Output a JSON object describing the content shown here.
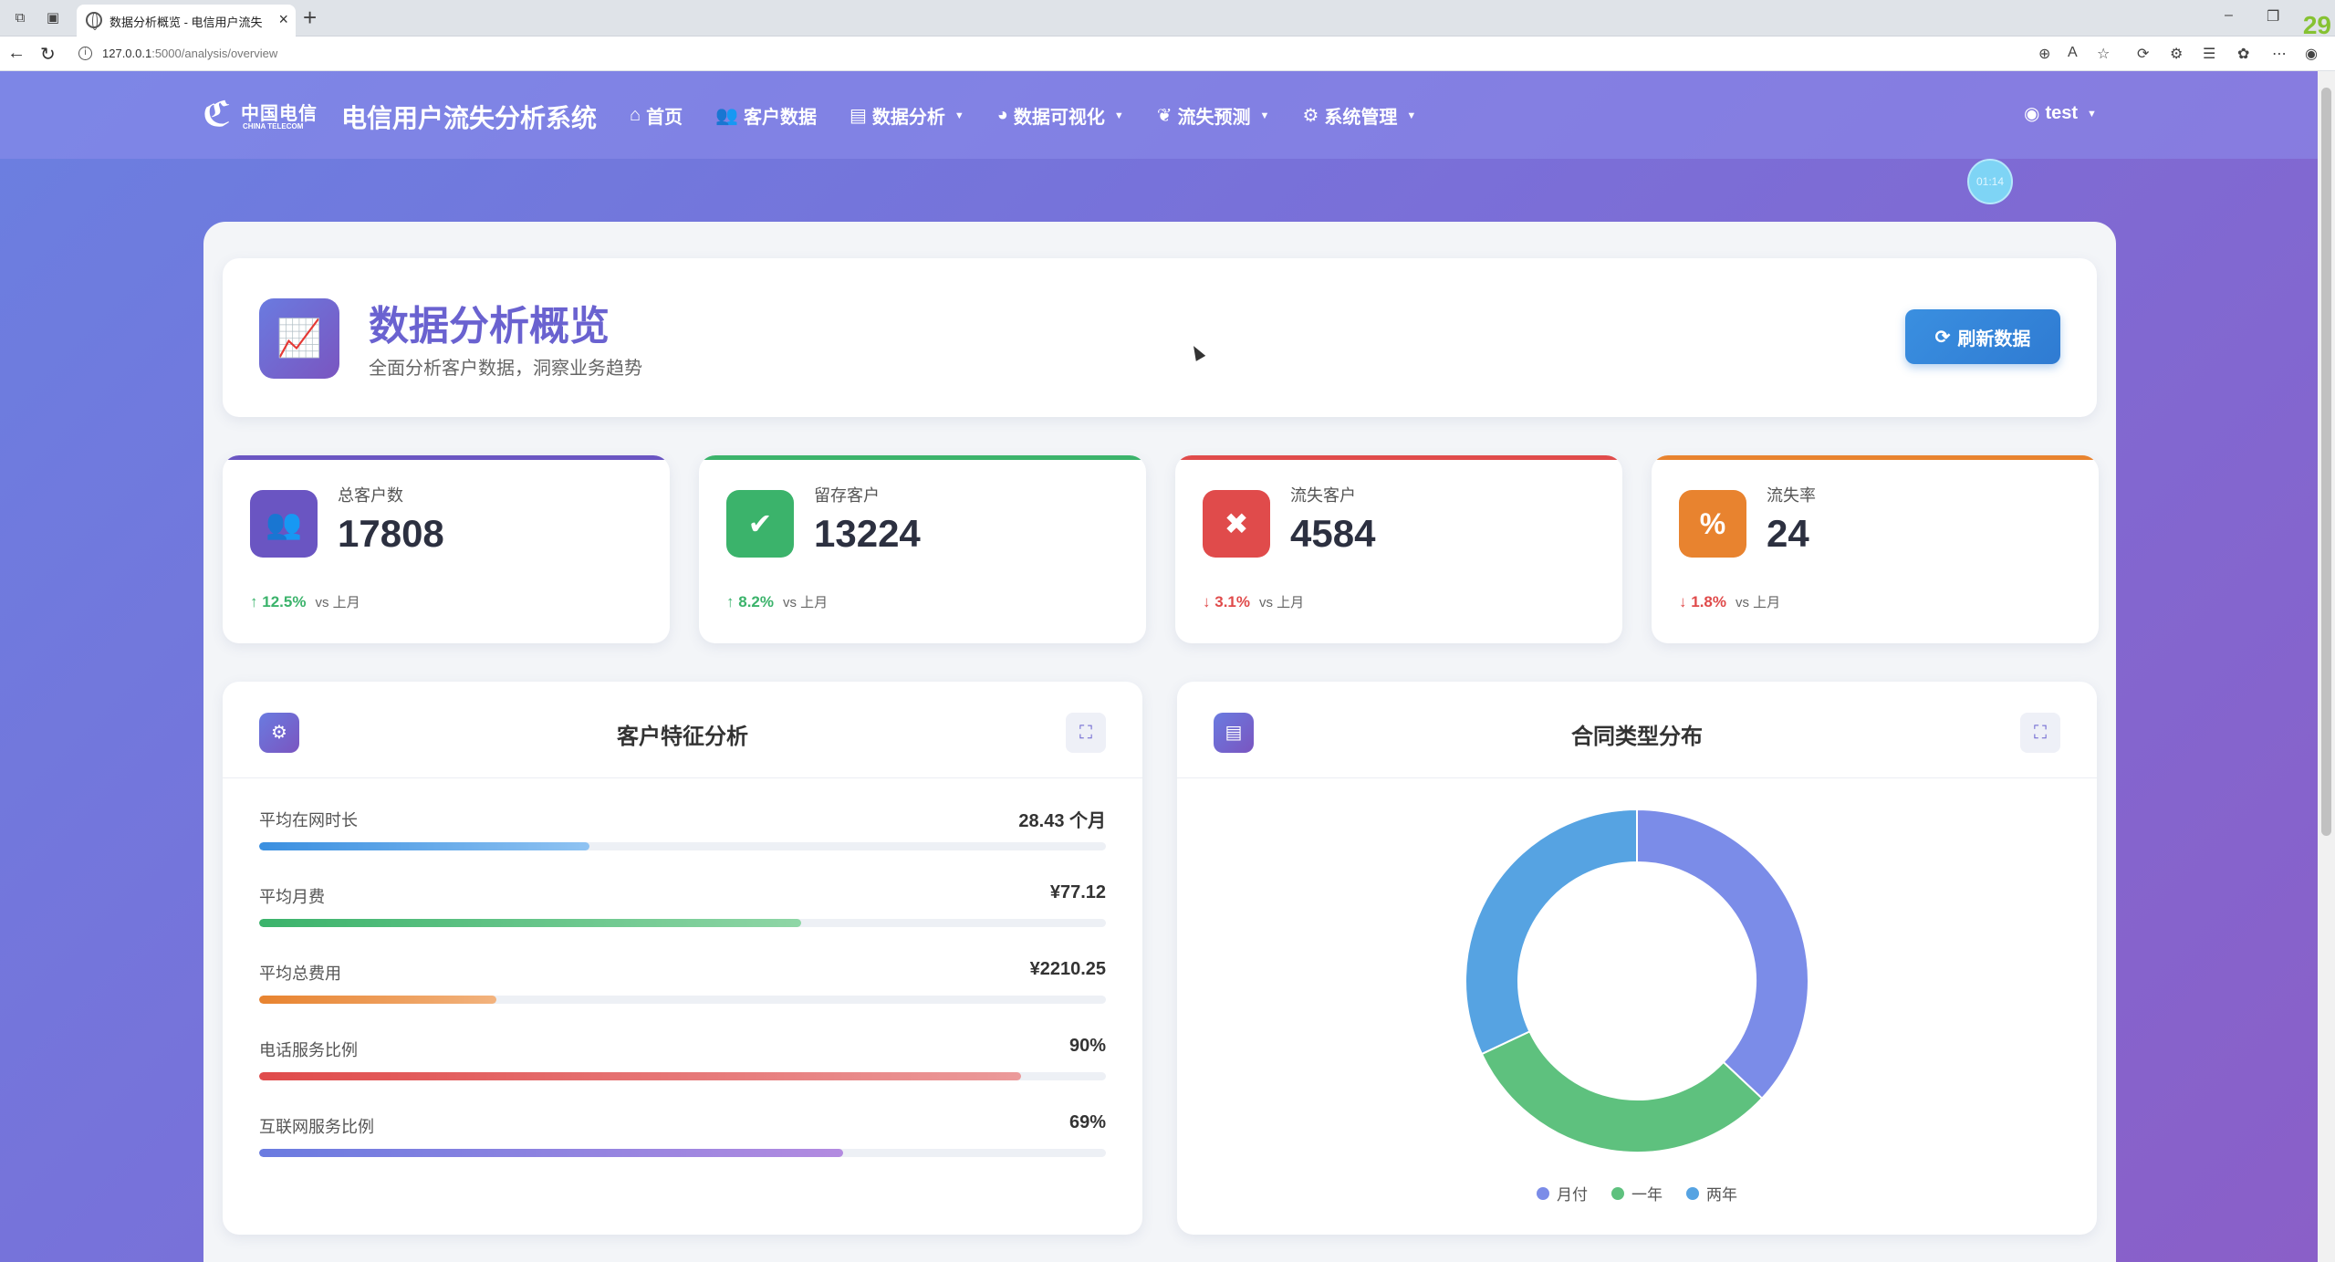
{
  "browser": {
    "tab_title": "数据分析概览 - 电信用户流失分析",
    "url_host": "127.0.0.1",
    "url_rest": ":5000/analysis/overview",
    "corner_number": "29"
  },
  "nav": {
    "logo_cn": "中国电信",
    "logo_en": "CHINA TELECOM",
    "brand": "电信用户流失分析系统",
    "items": [
      {
        "label": "首页",
        "icon": "home-icon",
        "dropdown": false
      },
      {
        "label": "客户数据",
        "icon": "users-icon",
        "dropdown": false
      },
      {
        "label": "数据分析",
        "icon": "bar-chart-icon",
        "dropdown": true
      },
      {
        "label": "数据可视化",
        "icon": "pie-chart-icon",
        "dropdown": true
      },
      {
        "label": "流失预测",
        "icon": "brain-icon",
        "dropdown": true
      },
      {
        "label": "系统管理",
        "icon": "gear-icon",
        "dropdown": true
      }
    ],
    "user": "test",
    "clock": "01:14"
  },
  "header": {
    "title": "数据分析概览",
    "subtitle": "全面分析客户数据，洞察业务趋势",
    "refresh_label": "刷新数据"
  },
  "stats": [
    {
      "label": "总客户数",
      "value": "17808",
      "trend": "12.5%",
      "direction": "up",
      "vs": "vs 上月",
      "color": "#6a55c2",
      "bar": "#6a55c2",
      "icon": "users-icon",
      "glyph": "👥"
    },
    {
      "label": "留存客户",
      "value": "13224",
      "trend": "8.2%",
      "direction": "up",
      "vs": "vs 上月",
      "color": "#3bb36b",
      "bar": "#3bb36b",
      "icon": "user-check-icon",
      "glyph": "✔"
    },
    {
      "label": "流失客户",
      "value": "4584",
      "trend": "3.1%",
      "direction": "down",
      "vs": "vs 上月",
      "color": "#e04b4b",
      "bar": "#e04b4b",
      "icon": "user-times-icon",
      "glyph": "✖"
    },
    {
      "label": "流失率",
      "value": "24",
      "trend": "1.8%",
      "direction": "down",
      "vs": "vs 上月",
      "color": "#e8832f",
      "bar": "#e8832f",
      "icon": "percent-icon",
      "glyph": "%"
    }
  ],
  "features": {
    "title": "客户特征分析",
    "metrics": [
      {
        "label": "平均在网时长",
        "value": "28.43 个月",
        "fill": 0.39,
        "c1": "#3a8fe0",
        "c2": "#8fc3f2"
      },
      {
        "label": "平均月费",
        "value": "¥77.12",
        "fill": 0.64,
        "c1": "#3bb36b",
        "c2": "#8fd6a6"
      },
      {
        "label": "平均总费用",
        "value": "¥2210.25",
        "fill": 0.28,
        "c1": "#e8832f",
        "c2": "#f2b37e"
      },
      {
        "label": "电话服务比例",
        "value": "90%",
        "fill": 0.9,
        "c1": "#e04b4b",
        "c2": "#eb9a9a"
      },
      {
        "label": "互联网服务比例",
        "value": "69%",
        "fill": 0.69,
        "c1": "#6a7be0",
        "c2": "#b38be0"
      }
    ]
  },
  "contract": {
    "title": "合同类型分布"
  },
  "chart_data": {
    "type": "pie",
    "title": "合同类型分布",
    "categories": [
      "月付",
      "一年",
      "两年"
    ],
    "values": [
      37,
      31,
      32
    ],
    "colors": [
      "#7b8ce8",
      "#5ec17e",
      "#56a3e2"
    ],
    "legend": "bottom"
  }
}
